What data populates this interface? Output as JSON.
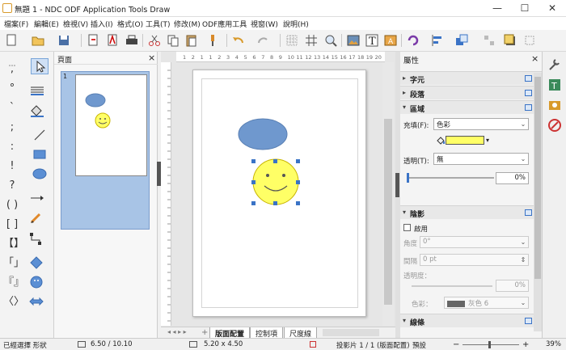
{
  "window": {
    "title": "無題 1 - NDC ODF Application Tools Draw",
    "minimize": "—",
    "maximize": "☐",
    "close": "✕"
  },
  "menu": [
    "檔案(F)",
    "編輯(E)",
    "檢視(V)",
    "插入(I)",
    "格式(O)",
    "工具(T)",
    "修改(M)",
    "ODF應用工具",
    "視窗(W)",
    "說明(H)"
  ],
  "pages_panel": {
    "title": "頁面",
    "close": "×",
    "thumb_number": "1"
  },
  "ruler": {
    "h_ticks": [
      "1",
      "2",
      "1",
      "1",
      "2",
      "3",
      "4",
      "5",
      "6",
      "7",
      "8",
      "9",
      "10",
      "11",
      "12",
      "13",
      "14",
      "15",
      "16",
      "17",
      "18",
      "19",
      "20"
    ]
  },
  "tabs": [
    "版面配置",
    "控制項",
    "尺度線"
  ],
  "sidebar": {
    "title": "屬性",
    "close": "×",
    "sections": {
      "character": "字元",
      "paragraph": "段落",
      "area": "區域",
      "shadow": "陰影",
      "line": "線條"
    },
    "area": {
      "fill_label": "充填(F):",
      "fill_value": "色彩",
      "fill_color": "#ffff66",
      "transparency_label": "透明(T):",
      "transparency_value": "無",
      "transparency_percent": "0%",
      "slider_value": 0
    },
    "shadow": {
      "enable_label": "啟用",
      "enable_checked": false,
      "angle_label": "角度",
      "angle_value": "0°",
      "distance_label": "間隔",
      "distance_value": "0 pt",
      "transparency_label": "透明度：",
      "transparency_percent": "0%",
      "color_label": "色彩：",
      "color_value": "灰色 6",
      "color_swatch": "#666666"
    }
  },
  "status": {
    "selection": "已經選擇 形狀",
    "position": "6.50 / 10.10",
    "size": "5.20 x 4.50",
    "slide": "投影片 1 / 1 (版面配置)",
    "layout": "預設",
    "zoom": "39%"
  },
  "colors": {
    "ellipse": "#6f98ce",
    "smiley": "#ffff66",
    "smiley_stroke": "#c8b400",
    "accent": "#3a73c6"
  }
}
